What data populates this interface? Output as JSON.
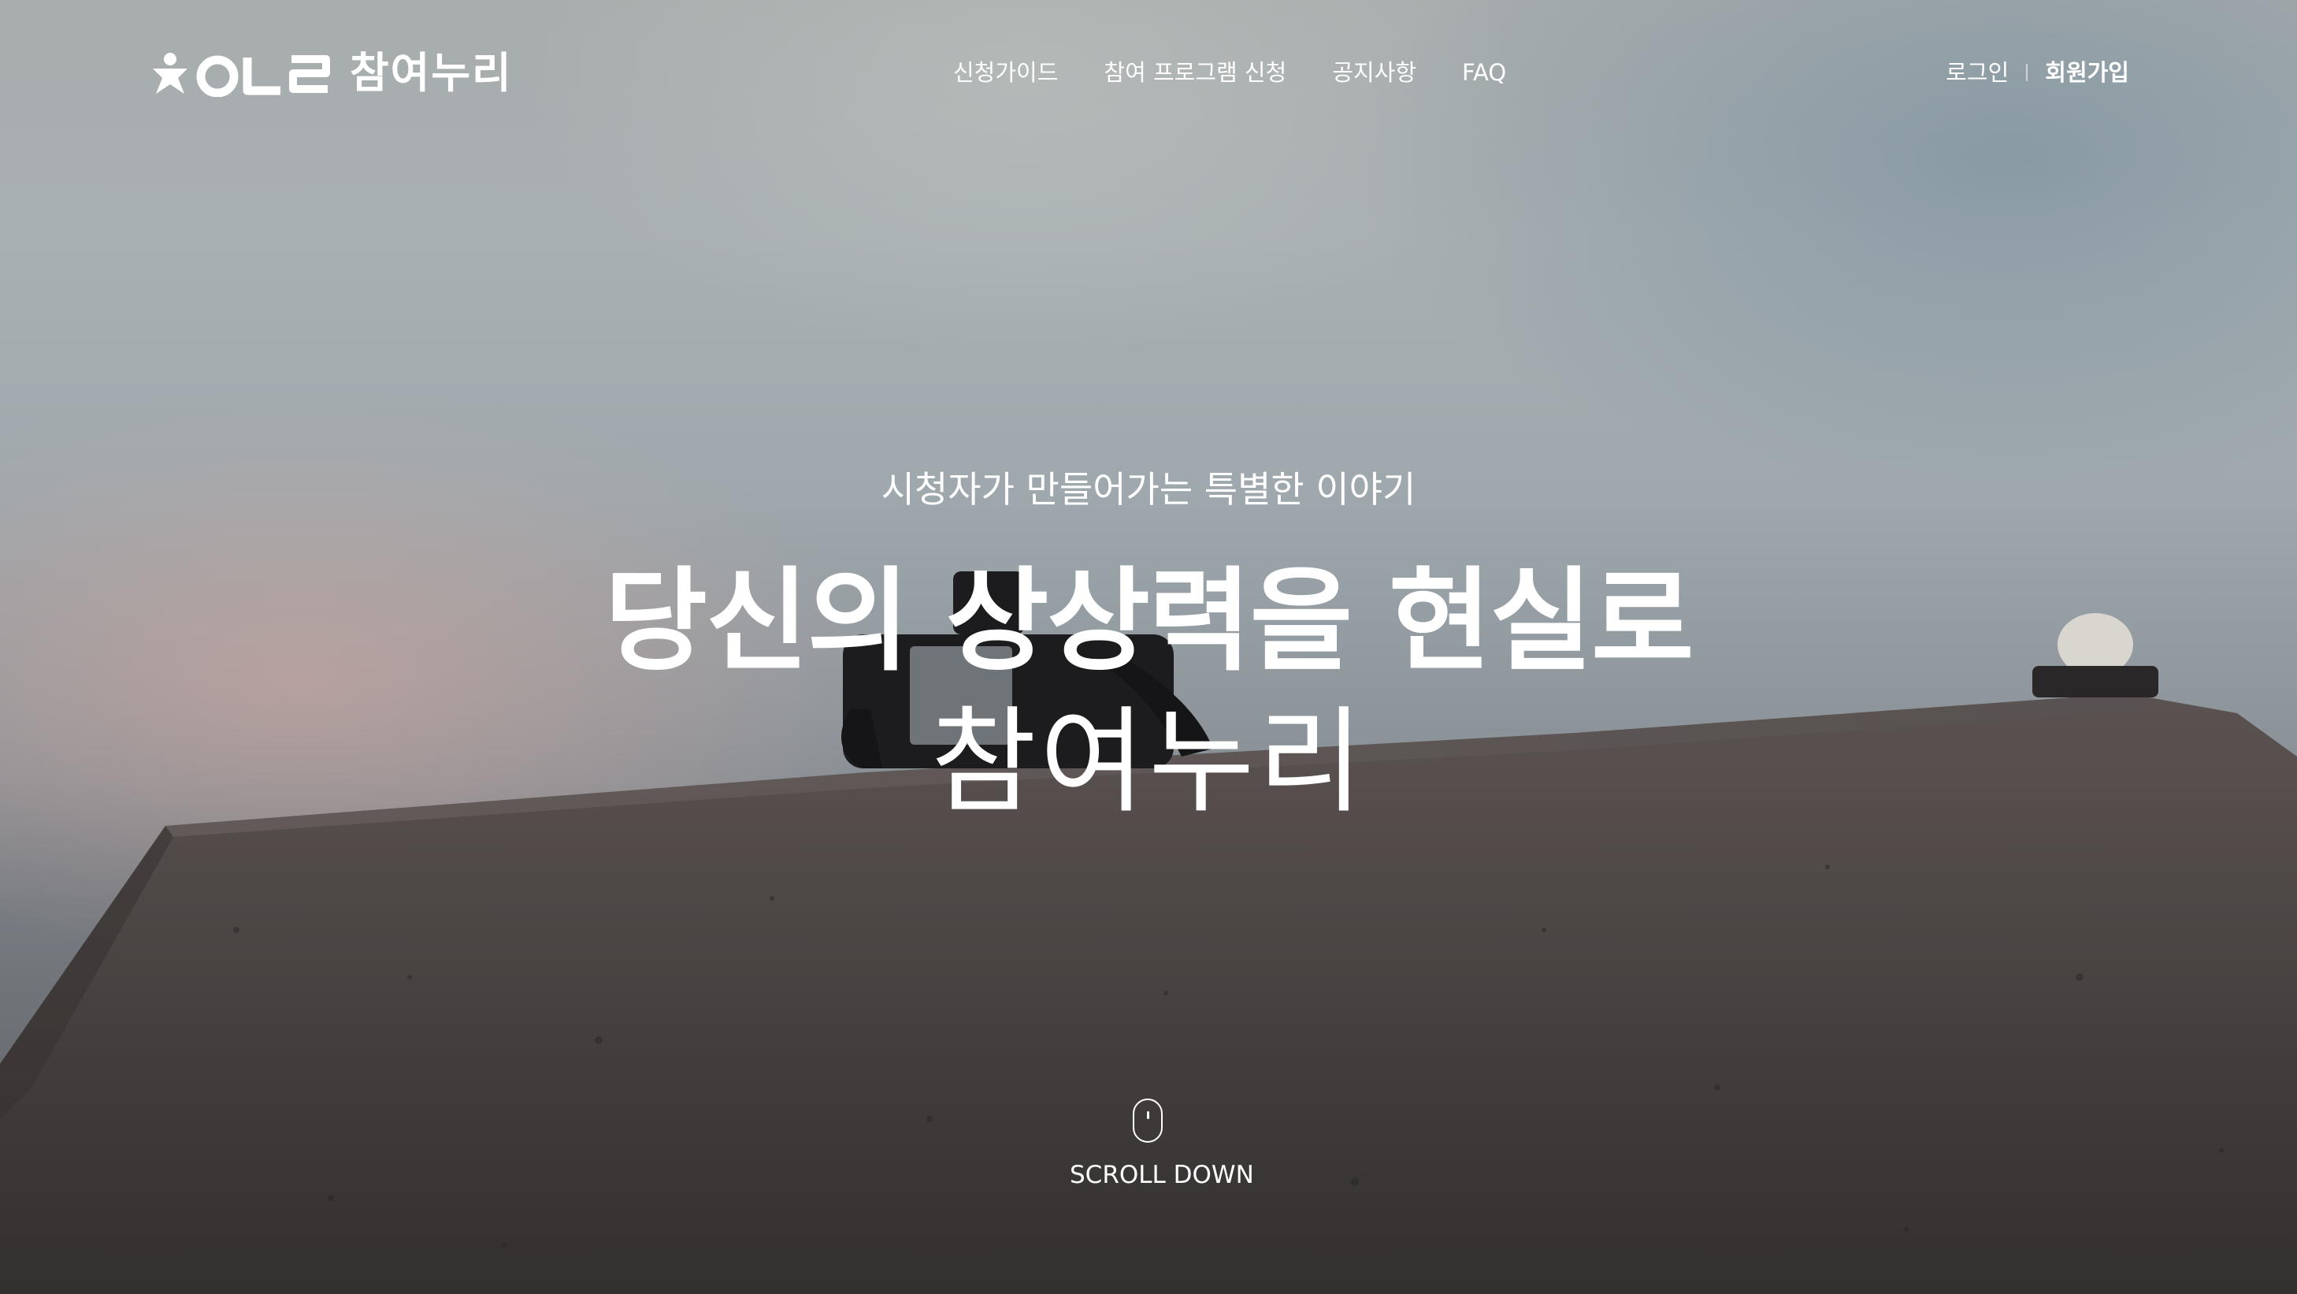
{
  "brand": {
    "logo_text": "참여누리"
  },
  "nav": {
    "items": [
      {
        "label": "신청가이드"
      },
      {
        "label": "참여 프로그램 신청"
      },
      {
        "label": "공지사항"
      },
      {
        "label": "FAQ"
      }
    ]
  },
  "auth": {
    "login": "로그인",
    "signup": "회원가입"
  },
  "hero": {
    "subtitle": "시청자가 만들어가는 특별한 이야기",
    "title": "당신의 상상력을 현실로",
    "brand_line": "참여누리"
  },
  "scroll": {
    "label": "SCROLL DOWN"
  },
  "colors": {
    "text": "#ffffff",
    "sky_top": "#a8adad",
    "sky_glow": "#d6a89e",
    "wall": "#4e4948"
  }
}
